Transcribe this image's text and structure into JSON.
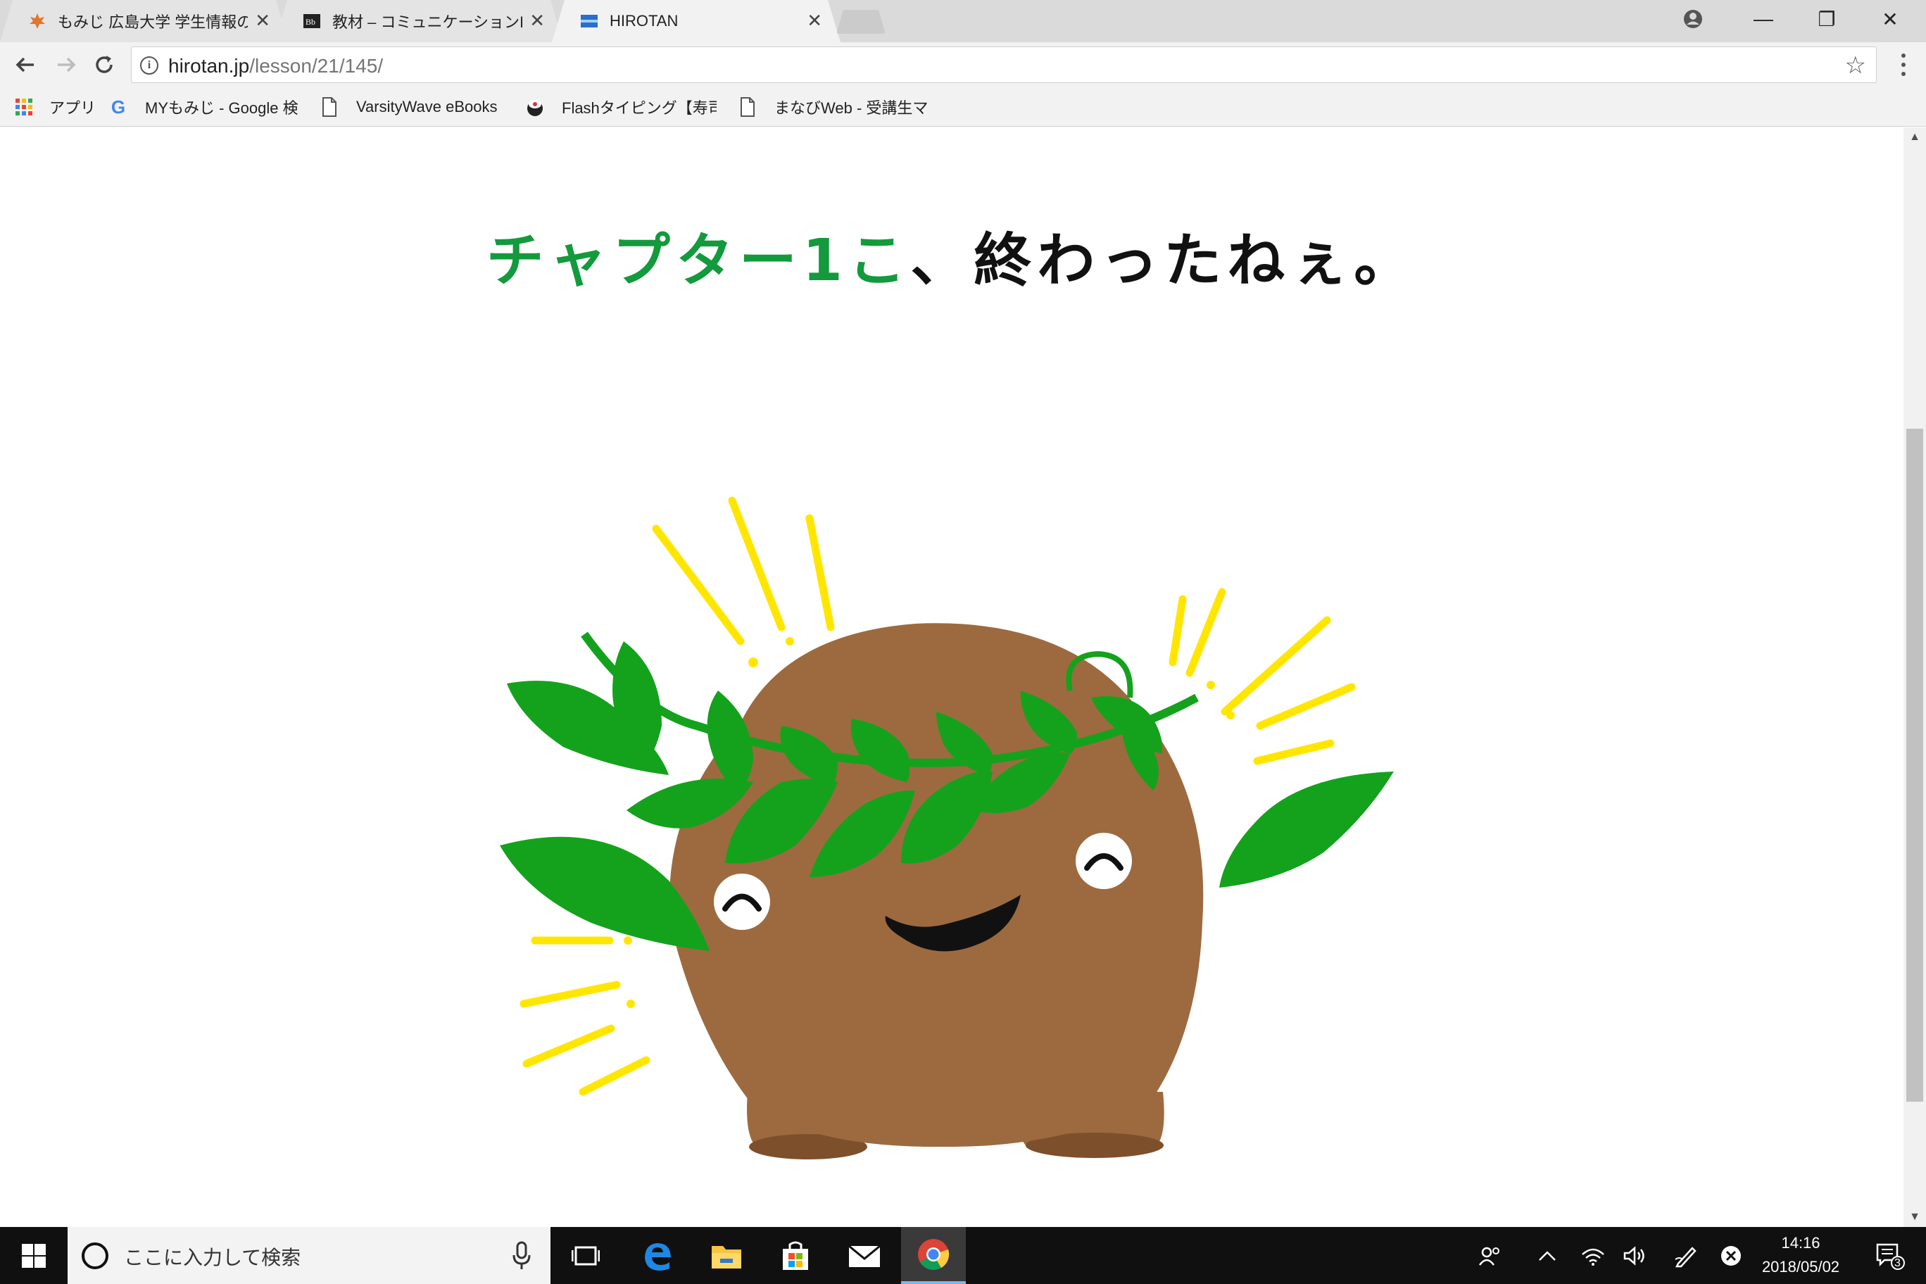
{
  "browser": {
    "tabs": [
      {
        "title": "もみじ 広島大学 学生情報の",
        "active": false,
        "favicon": "momiji-leaf-icon"
      },
      {
        "title": "教材 – コミュニケーションIA・II",
        "active": false,
        "favicon": "blackboard-icon"
      },
      {
        "title": "HIROTAN",
        "active": true,
        "favicon": "hirotan-icon"
      }
    ],
    "tab_close_glyph": "✕",
    "window_controls": {
      "minimize": "—",
      "maximize": "❐",
      "close": "✕"
    },
    "address_bar": {
      "host": "hirotan.jp",
      "path": "/lesson/21/145/",
      "info_glyph": "i",
      "star_glyph": "☆"
    },
    "bookmarks": [
      {
        "label": "アプリ",
        "icon": "apps-grid-icon"
      },
      {
        "label": "MYもみじ - Google 検",
        "icon": "google-icon"
      },
      {
        "label": "VarsityWave eBooks",
        "icon": "page-icon"
      },
      {
        "label": "Flashタイピング【寿司打",
        "icon": "sushi-icon"
      },
      {
        "label": "まなびWeb - 受講生マ",
        "icon": "page-icon"
      }
    ]
  },
  "page": {
    "headline_green": "チャプター1こ",
    "headline_black": "、終わったねぇ。"
  },
  "scrollbar": {
    "up": "▲",
    "down": "▼"
  },
  "taskbar": {
    "search_placeholder": "ここに入力して検索",
    "time": "14:16",
    "date": "2018/05/02",
    "notification_count": "3",
    "accent": "#76b9ed"
  }
}
